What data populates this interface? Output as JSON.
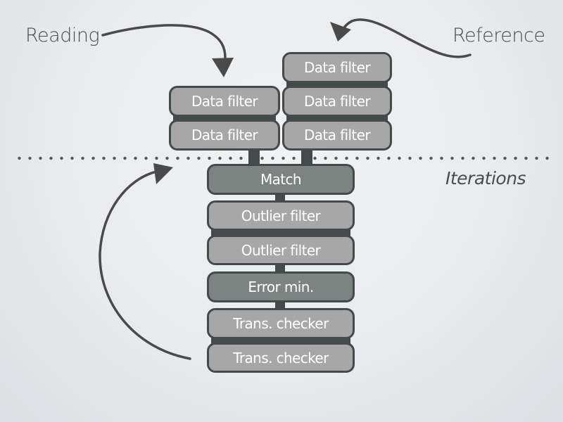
{
  "labels": {
    "reading": "Reading",
    "reference": "Reference",
    "iterations": "Iterations"
  },
  "reading_column": [
    {
      "label": "Data filter"
    },
    {
      "label": "Data filter"
    }
  ],
  "reference_column": [
    {
      "label": "Data filter"
    },
    {
      "label": "Data filter"
    },
    {
      "label": "Data filter"
    }
  ],
  "pipeline": [
    {
      "label": "Match",
      "style": "dark"
    },
    {
      "label": "Outlier filter",
      "style": "light"
    },
    {
      "label": "Outlier filter",
      "style": "light"
    },
    {
      "label": "Error min.",
      "style": "dark"
    },
    {
      "label": "Trans. checker",
      "style": "light"
    },
    {
      "label": "Trans. checker",
      "style": "light"
    }
  ],
  "colors": {
    "box_light": "#a7a7a7",
    "box_dark": "#7d8381",
    "border": "#444a4a",
    "text": "#ffffff",
    "arrow": "#4a4a4a"
  }
}
